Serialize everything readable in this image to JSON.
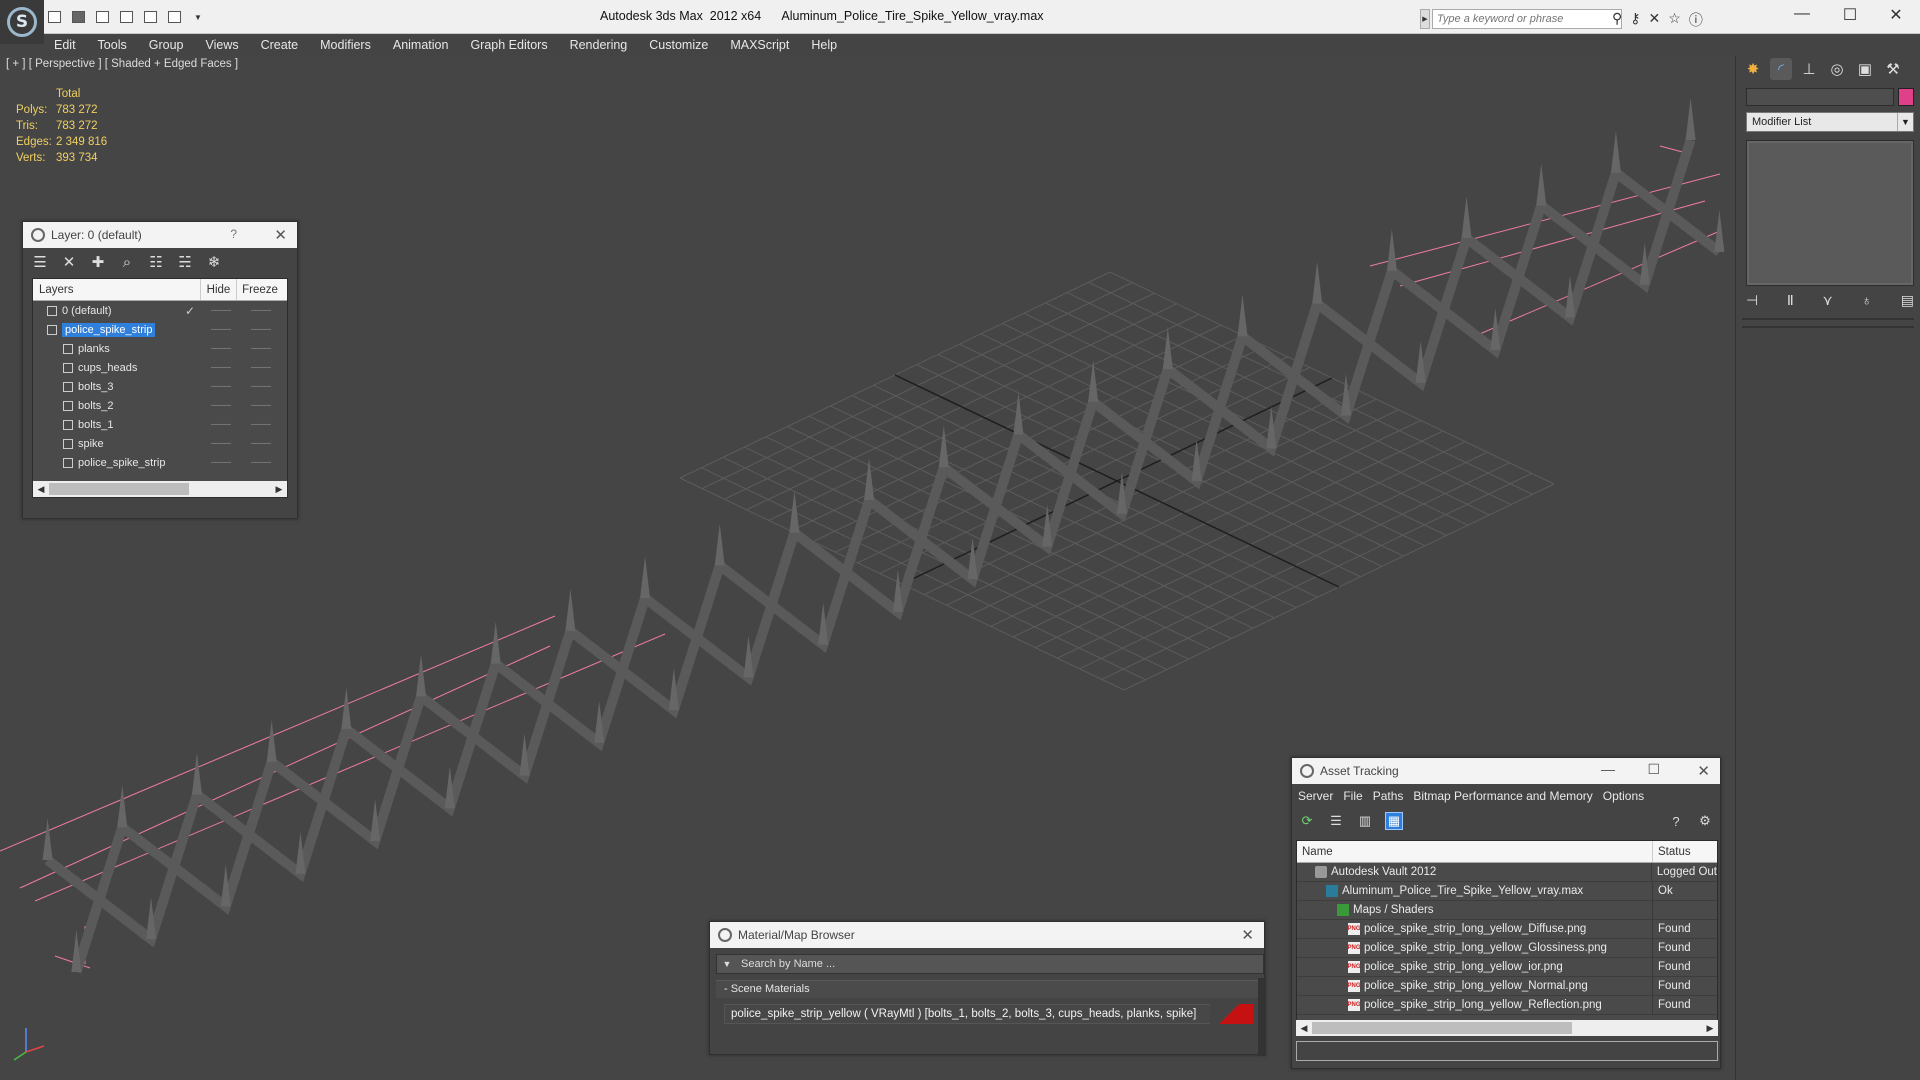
{
  "window": {
    "app_title": "Autodesk 3ds Max  2012 x64",
    "file_name": "Aluminum_Police_Tire_Spike_Yellow_vray.max",
    "search_placeholder": "Type a keyword or phrase",
    "minimize": "—",
    "maximize": "☐",
    "close": "✕"
  },
  "menu": [
    "Edit",
    "Tools",
    "Group",
    "Views",
    "Create",
    "Modifiers",
    "Animation",
    "Graph Editors",
    "Rendering",
    "Customize",
    "MAXScript",
    "Help"
  ],
  "viewport": {
    "label": "[ + ] [ Perspective ] [ Shaded + Edged Faces ]",
    "stats": {
      "header": "Total",
      "rows": [
        {
          "k": "Polys:",
          "v": "783 272"
        },
        {
          "k": "Tris:",
          "v": "783 272"
        },
        {
          "k": "Edges:",
          "v": "2 349 816"
        },
        {
          "k": "Verts:",
          "v": "393 734"
        }
      ]
    },
    "colors": {
      "background": "#454545",
      "grid": "#5c5c5c",
      "bbox": "#f07aa8",
      "mesh": "#5a5a5a"
    }
  },
  "command_panel": {
    "modifier_list": "Modifier List",
    "object_color": "#e0408a"
  },
  "layer_panel": {
    "title": "Layer: 0 (default)",
    "help": "?",
    "columns": {
      "layers": "Layers",
      "hide": "Hide",
      "freeze": "Freeze"
    },
    "rows": [
      {
        "name": "0 (default)",
        "indent": 0,
        "current": true
      },
      {
        "name": "police_spike_strip",
        "indent": 0,
        "selected": true
      },
      {
        "name": "planks",
        "indent": 1
      },
      {
        "name": "cups_heads",
        "indent": 1
      },
      {
        "name": "bolts_3",
        "indent": 1
      },
      {
        "name": "bolts_2",
        "indent": 1
      },
      {
        "name": "bolts_1",
        "indent": 1
      },
      {
        "name": "spike",
        "indent": 1
      },
      {
        "name": "police_spike_strip",
        "indent": 1
      }
    ],
    "dash": "——"
  },
  "material_browser": {
    "title": "Material/Map Browser",
    "search_placeholder": "Search by Name ...",
    "section": "- Scene Materials",
    "item": "police_spike_strip_yellow ( VRayMtl ) [bolts_1, bolts_2, bolts_3, cups_heads, planks, spike]",
    "swatch_color": "#c51111"
  },
  "asset_tracking": {
    "title": "Asset Tracking",
    "menu": [
      "Server",
      "File",
      "Paths",
      "Bitmap Performance and Memory",
      "Options"
    ],
    "columns": {
      "name": "Name",
      "status": "Status"
    },
    "rows": [
      {
        "name": "Autodesk Vault 2012",
        "status": "Logged Out",
        "icon": "vault",
        "indent": 2
      },
      {
        "name": "Aluminum_Police_Tire_Spike_Yellow_vray.max",
        "status": "Ok",
        "icon": "max",
        "indent": 3
      },
      {
        "name": "Maps / Shaders",
        "status": "",
        "icon": "folder",
        "indent": 4
      },
      {
        "name": "police_spike_strip_long_yellow_Diffuse.png",
        "status": "Found",
        "icon": "png",
        "indent": 5
      },
      {
        "name": "police_spike_strip_long_yellow_Glossiness.png",
        "status": "Found",
        "icon": "png",
        "indent": 5
      },
      {
        "name": "police_spike_strip_long_yellow_ior.png",
        "status": "Found",
        "icon": "png",
        "indent": 5
      },
      {
        "name": "police_spike_strip_long_yellow_Normal.png",
        "status": "Found",
        "icon": "png",
        "indent": 5
      },
      {
        "name": "police_spike_strip_long_yellow_Reflection.png",
        "status": "Found",
        "icon": "png",
        "indent": 5
      }
    ]
  }
}
